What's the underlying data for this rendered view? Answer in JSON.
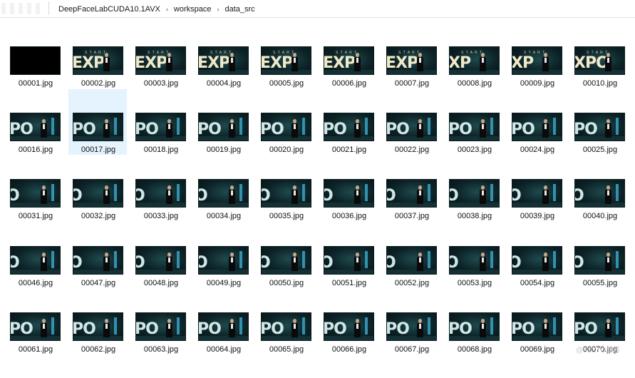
{
  "breadcrumb": [
    "DeepFaceLabCUDA10.1AVX",
    "workspace",
    "data_src"
  ],
  "thumbnails": {
    "big_text_legend": "frames 2-10 show EXPO letters, later rows show po",
    "selected": "00017.jpg"
  },
  "files": [
    {
      "name": "00001.jpg",
      "kind": "black"
    },
    {
      "name": "00002.jpg",
      "kind": "exp",
      "text": "EXP"
    },
    {
      "name": "00003.jpg",
      "kind": "exp",
      "text": "EXP"
    },
    {
      "name": "00004.jpg",
      "kind": "exp",
      "text": "EXP"
    },
    {
      "name": "00005.jpg",
      "kind": "exp",
      "text": "EXP"
    },
    {
      "name": "00006.jpg",
      "kind": "exp",
      "text": "EXP"
    },
    {
      "name": "00007.jpg",
      "kind": "exp",
      "text": "EXP"
    },
    {
      "name": "00008.jpg",
      "kind": "exp",
      "text": "XP"
    },
    {
      "name": "00009.jpg",
      "kind": "exp",
      "text": "XP"
    },
    {
      "name": "00010.jpg",
      "kind": "exp",
      "text": "XPO"
    },
    {
      "name": "00016.jpg",
      "kind": "po",
      "text": "PO"
    },
    {
      "name": "00017.jpg",
      "kind": "po",
      "text": "PO"
    },
    {
      "name": "00018.jpg",
      "kind": "po",
      "text": "PO"
    },
    {
      "name": "00019.jpg",
      "kind": "po",
      "text": "PO"
    },
    {
      "name": "00020.jpg",
      "kind": "po",
      "text": "PO"
    },
    {
      "name": "00021.jpg",
      "kind": "po",
      "text": "PO"
    },
    {
      "name": "00022.jpg",
      "kind": "po",
      "text": "PO"
    },
    {
      "name": "00023.jpg",
      "kind": "po",
      "text": "PO"
    },
    {
      "name": "00024.jpg",
      "kind": "po",
      "text": "PO"
    },
    {
      "name": "00025.jpg",
      "kind": "po",
      "text": "PO"
    },
    {
      "name": "00031.jpg",
      "kind": "o",
      "text": "O"
    },
    {
      "name": "00032.jpg",
      "kind": "o",
      "text": "O"
    },
    {
      "name": "00033.jpg",
      "kind": "o",
      "text": "O"
    },
    {
      "name": "00034.jpg",
      "kind": "o",
      "text": "O"
    },
    {
      "name": "00035.jpg",
      "kind": "o",
      "text": "O"
    },
    {
      "name": "00036.jpg",
      "kind": "o",
      "text": "O"
    },
    {
      "name": "00037.jpg",
      "kind": "o",
      "text": "O"
    },
    {
      "name": "00038.jpg",
      "kind": "o",
      "text": "O"
    },
    {
      "name": "00039.jpg",
      "kind": "o",
      "text": "O"
    },
    {
      "name": "00040.jpg",
      "kind": "o",
      "text": "O"
    },
    {
      "name": "00046.jpg",
      "kind": "o",
      "text": "O"
    },
    {
      "name": "00047.jpg",
      "kind": "o",
      "text": "O"
    },
    {
      "name": "00048.jpg",
      "kind": "o",
      "text": "O"
    },
    {
      "name": "00049.jpg",
      "kind": "o",
      "text": "O"
    },
    {
      "name": "00050.jpg",
      "kind": "o",
      "text": "O"
    },
    {
      "name": "00051.jpg",
      "kind": "o",
      "text": "O"
    },
    {
      "name": "00052.jpg",
      "kind": "o",
      "text": "O"
    },
    {
      "name": "00053.jpg",
      "kind": "o",
      "text": "O"
    },
    {
      "name": "00054.jpg",
      "kind": "o",
      "text": "O"
    },
    {
      "name": "00055.jpg",
      "kind": "o",
      "text": "O"
    },
    {
      "name": "00061.jpg",
      "kind": "po",
      "text": "PO"
    },
    {
      "name": "00062.jpg",
      "kind": "po",
      "text": "PO"
    },
    {
      "name": "00063.jpg",
      "kind": "po",
      "text": "PO"
    },
    {
      "name": "00064.jpg",
      "kind": "po",
      "text": "PO"
    },
    {
      "name": "00065.jpg",
      "kind": "po",
      "text": "PO"
    },
    {
      "name": "00066.jpg",
      "kind": "po",
      "text": "PO"
    },
    {
      "name": "00067.jpg",
      "kind": "po",
      "text": "PO"
    },
    {
      "name": "00068.jpg",
      "kind": "po",
      "text": "PO"
    },
    {
      "name": "00069.jpg",
      "kind": "po",
      "text": "PO"
    },
    {
      "name": "00070.jpg",
      "kind": "po",
      "text": "PO"
    }
  ],
  "watermark": "@51CTO博客"
}
